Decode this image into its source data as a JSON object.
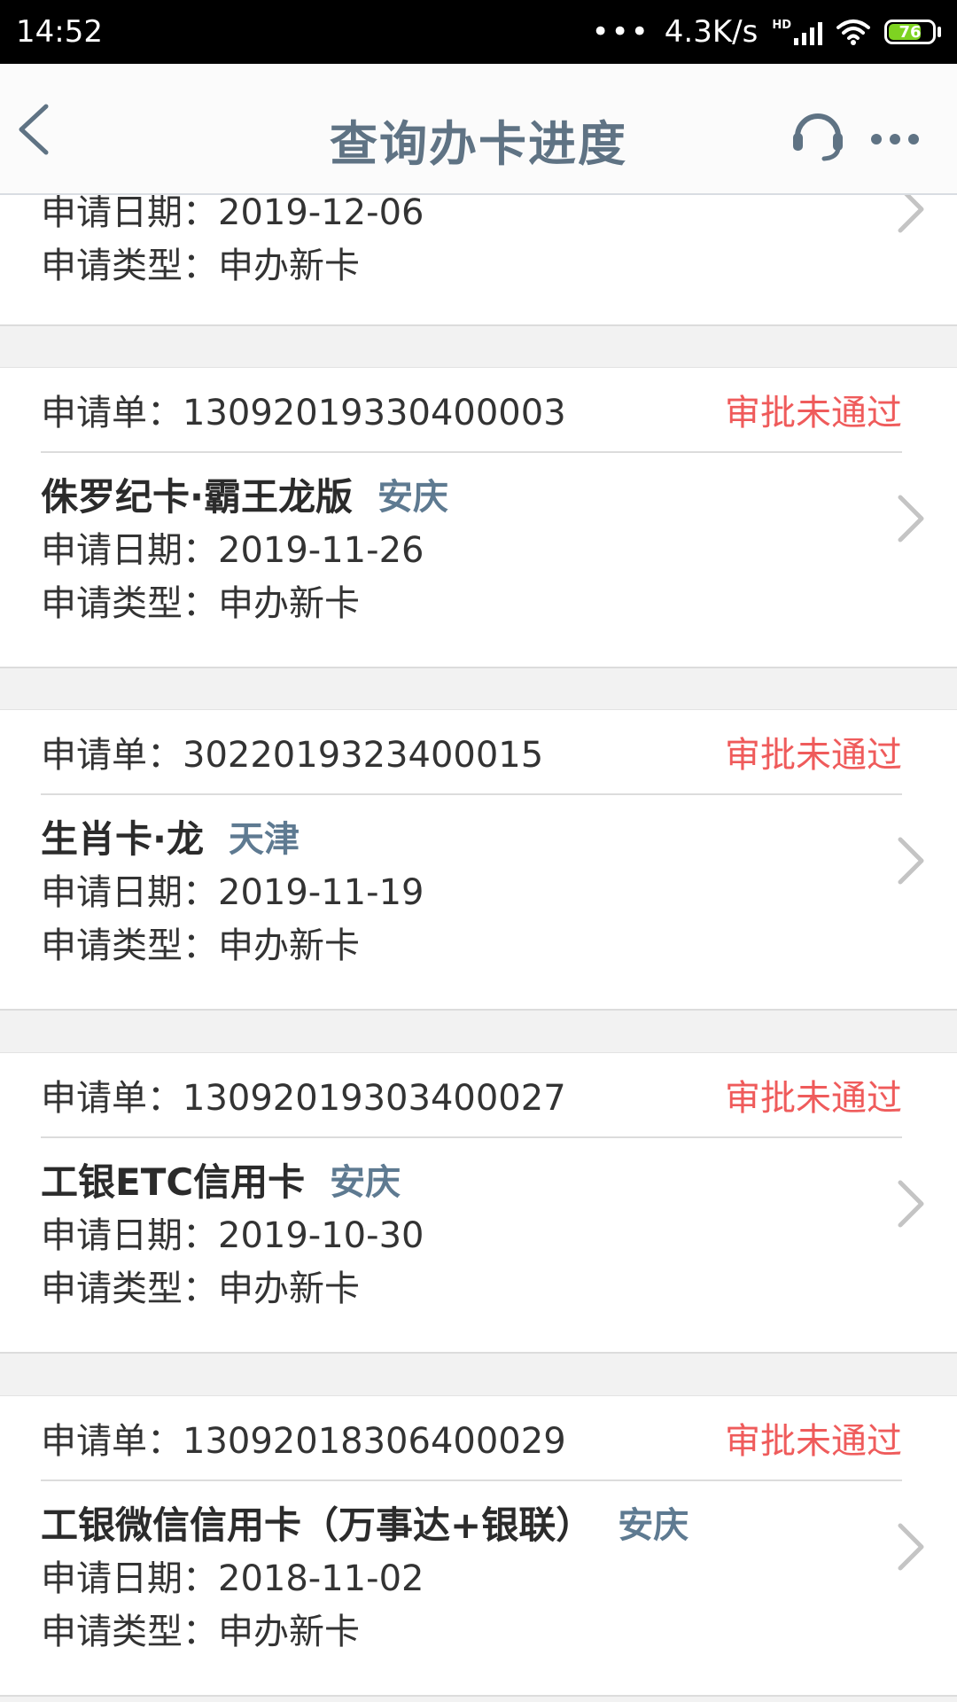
{
  "status_bar": {
    "time": "14:52",
    "dots": "•••",
    "net_speed": "4.3K/s",
    "hd_label": "HD",
    "battery": "76",
    "battery_level": 0.76
  },
  "nav": {
    "title": "查询办卡进度",
    "back_icon": "chevron-left-icon",
    "service_icon": "headset-icon",
    "more_icon": "more-dots-icon"
  },
  "partial_card": {
    "date_label": "申请日期：",
    "date": "2019-12-06",
    "type_label": "申请类型：",
    "type": "申办新卡"
  },
  "labels": {
    "order_prefix": "申请单：",
    "date_label": "申请日期：",
    "type_label": "申请类型："
  },
  "applications": [
    {
      "order_no": "13092019330400003",
      "status": "审批未通过",
      "card_name": "侏罗纪卡·霸王龙版",
      "region": "安庆",
      "date": "2019-11-26",
      "type": "申办新卡"
    },
    {
      "order_no": "3022019323400015",
      "status": "审批未通过",
      "card_name": "生肖卡·龙",
      "region": "天津",
      "date": "2019-11-19",
      "type": "申办新卡"
    },
    {
      "order_no": "13092019303400027",
      "status": "审批未通过",
      "card_name": "工银ETC信用卡",
      "region": "安庆",
      "date": "2019-10-30",
      "type": "申办新卡"
    },
    {
      "order_no": "13092018306400029",
      "status": "审批未通过",
      "card_name": "工银微信信用卡（万事达+银联）",
      "region": "安庆",
      "date": "2018-11-02",
      "type": "申办新卡"
    }
  ],
  "colors": {
    "title": "#5f7384",
    "status_rejected": "#ef5b5b",
    "region": "#5e7a91",
    "battery": "#7ed321"
  }
}
